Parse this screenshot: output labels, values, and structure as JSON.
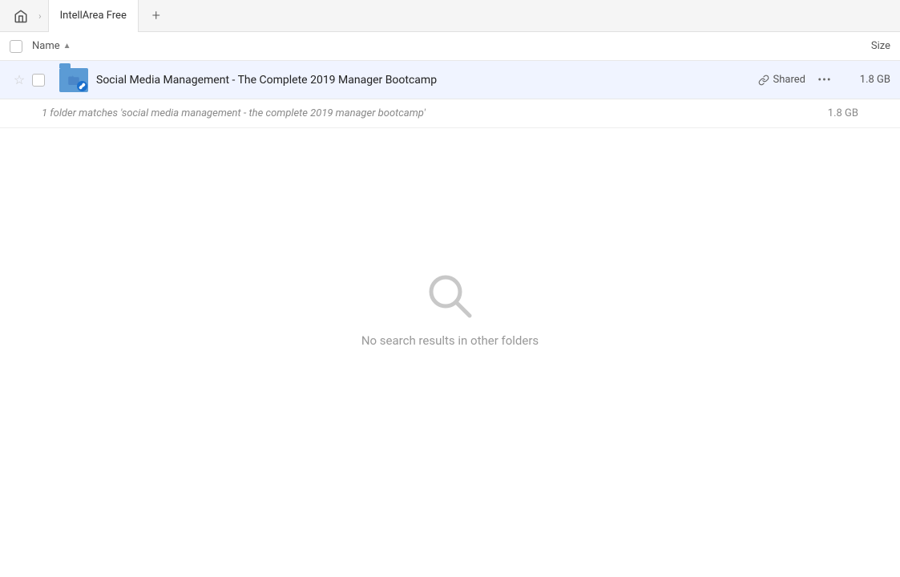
{
  "topbar": {
    "home_icon": "🏠",
    "separator": "›",
    "tab_label": "IntellArea Free",
    "add_tab_icon": "+"
  },
  "columns": {
    "name_label": "Name",
    "sort_icon": "▲",
    "size_label": "Size"
  },
  "file_row": {
    "star_icon": "☆",
    "file_name": "Social Media Management - The Complete 2019 Manager Bootcamp",
    "shared_label": "Shared",
    "more_icon": "···",
    "file_size": "1.8 GB"
  },
  "results_summary": {
    "text": "1 folder matches 'social media management - the complete 2019 manager bootcamp'",
    "size": "1.8 GB"
  },
  "empty_state": {
    "message": "No search results in other folders"
  }
}
